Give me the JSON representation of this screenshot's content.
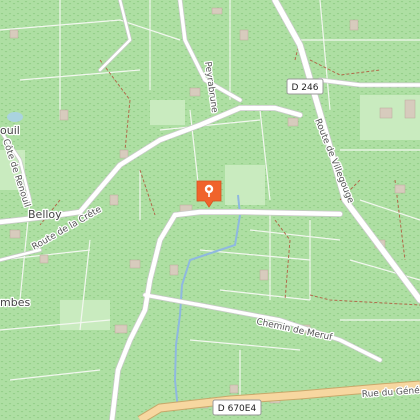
{
  "map": {
    "background_color": "#aedfa3",
    "vineyard_color": "#aedfa3",
    "road_color": "#ffffff",
    "primary_road_color": "#f7d7a0",
    "water_color": "#8fb8e0",
    "marker_color": "#f0632b"
  },
  "labels": {
    "peyrabrune": "Peyrabrune",
    "route_villegouge": "Route de Villegouge",
    "cote_renouil": "Côte de Renouil",
    "belloy": "Belloy",
    "route_crete": "Route de la Crête",
    "chemin_meruf": "Chemin de Meruf",
    "rue_general": "Rue du Génér",
    "ouil": "ouil",
    "mbes": "mbes"
  },
  "shields": {
    "d246": "D 246",
    "d670e4": "D 670E4"
  },
  "marker": {
    "icon": "location-pin-icon"
  }
}
